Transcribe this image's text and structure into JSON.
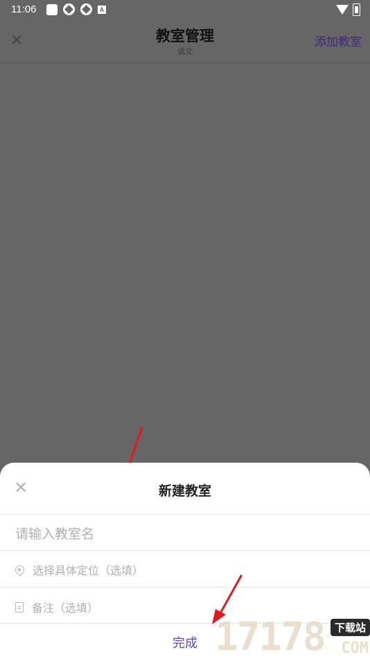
{
  "status_bar": {
    "time": "11:06"
  },
  "header": {
    "close_icon": "close-icon",
    "title": "教室管理",
    "subtitle": "语文",
    "add_label": "添加教室"
  },
  "sheet": {
    "close_icon": "close-icon",
    "title": "新建教室",
    "name_placeholder": "请输入教室名",
    "location_placeholder": "选择具体定位（选填）",
    "location_icon": "location-pin-icon",
    "note_placeholder": "备注（选填）",
    "note_icon": "document-icon",
    "done_label": "完成"
  },
  "watermark": {
    "number": "17178",
    "badge": "下载站",
    "domain": "COM"
  },
  "colors": {
    "overlay": "#666666",
    "accent": "#5a3fd0",
    "header_action": "#3b2b7a",
    "arrow": "#e0191b"
  }
}
